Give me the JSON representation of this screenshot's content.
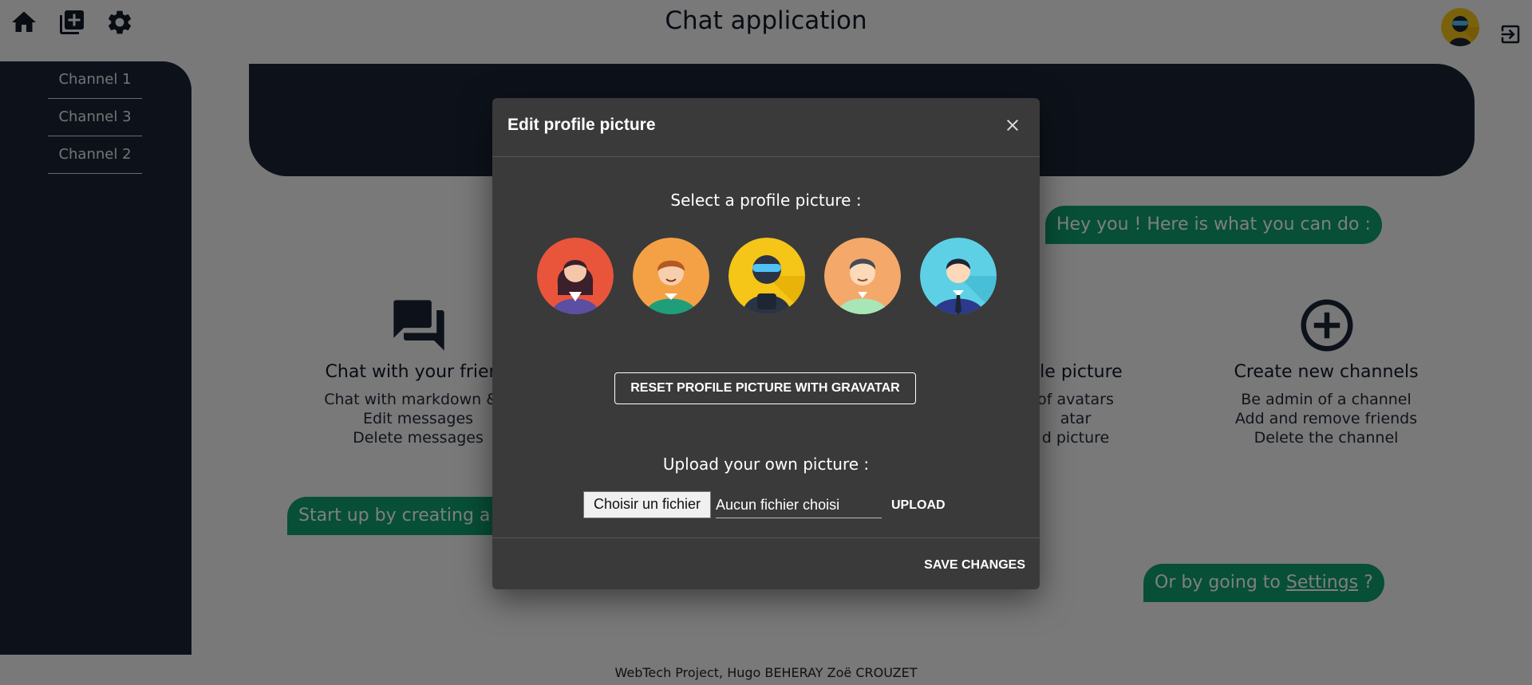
{
  "header": {
    "title": "Chat application",
    "icons": [
      "home-icon",
      "add-box-icon",
      "gear-icon",
      "user-avatar",
      "logout-icon"
    ]
  },
  "sidebar": {
    "channels": [
      {
        "label": "Channel 1"
      },
      {
        "label": "Channel 3"
      },
      {
        "label": "Channel 2"
      }
    ]
  },
  "main": {
    "bubble_intro": "Hey you ! Here is what you can do :",
    "bubble_start": "Start up by creating a ch",
    "bubble_settings_prefix": "Or by going to ",
    "bubble_settings_link": "Settings",
    "bubble_settings_suffix": " ?",
    "features": [
      {
        "title": "Chat with your friend",
        "lines": [
          "Chat with markdown & e",
          "Edit messages",
          "Delete messages"
        ],
        "icon": "forum-icon"
      },
      {
        "title": "file picture",
        "lines": [
          "of avatars",
          "atar",
          "d picture"
        ]
      },
      {
        "title": "Create new channels",
        "lines": [
          "Be admin of a channel",
          "Add and remove friends",
          "Delete the channel"
        ],
        "icon": "add-circle-icon"
      }
    ],
    "footer": "WebTech Project, Hugo BEHERAY Zoë CROUZET"
  },
  "dialog": {
    "title": "Edit profile picture",
    "select_label": "Select a profile picture :",
    "avatars": [
      "woman-avatar",
      "boy-avatar",
      "ninja-avatar",
      "man-avatar",
      "businessman-avatar"
    ],
    "reset_button": "RESET PROFILE PICTURE WITH GRAVATAR",
    "upload_label": "Upload your own picture :",
    "file_button": "Choisir un fichier",
    "file_name": "Aucun fichier choisi",
    "upload_button": "UPLOAD",
    "save_button": "SAVE CHANGES"
  },
  "colors": {
    "sidebar": "#1b2535",
    "bubble": "#0e9f6e",
    "dialog": "#3a3a3a",
    "overlay": "rgba(0,0,0,0.5)"
  }
}
